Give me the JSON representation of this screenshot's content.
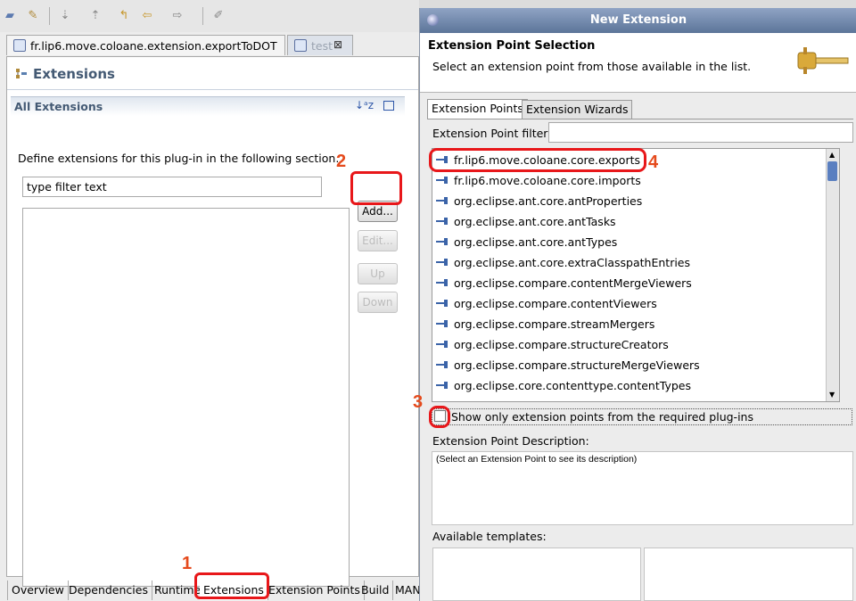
{
  "editor": {
    "tabs": [
      "fr.lip6.move.coloane.extension.exportToDOT",
      "test"
    ],
    "title": "Extensions",
    "section_title": "All Extensions",
    "section_desc": "Define extensions for this plug-in in the following section.",
    "filter_value": "type filter text",
    "buttons": {
      "add": "Add...",
      "edit": "Edit...",
      "up": "Up",
      "down": "Down"
    },
    "bottom_tabs": [
      "Overview",
      "Dependencies",
      "Runtime",
      "Extensions",
      "Extension Points",
      "Build",
      "MAN"
    ]
  },
  "dialog": {
    "title": "New Extension",
    "header_title": "Extension Point Selection",
    "header_desc": "Select an extension point from those available in the list.",
    "tabs": [
      "Extension Points",
      "Extension Wizards"
    ],
    "filter_label": "Extension Point filter:",
    "filter_value": "",
    "list": [
      "fr.lip6.move.coloane.core.exports",
      "fr.lip6.move.coloane.core.imports",
      "org.eclipse.ant.core.antProperties",
      "org.eclipse.ant.core.antTasks",
      "org.eclipse.ant.core.antTypes",
      "org.eclipse.ant.core.extraClasspathEntries",
      "org.eclipse.compare.contentMergeViewers",
      "org.eclipse.compare.contentViewers",
      "org.eclipse.compare.streamMergers",
      "org.eclipse.compare.structureCreators",
      "org.eclipse.compare.structureMergeViewers",
      "org.eclipse.core.contenttype.contentTypes"
    ],
    "checkbox_label": "Show only extension points from the required plug-ins",
    "desc_label": "Extension Point Description:",
    "desc_text": "(Select an Extension Point to see its description)",
    "templates_label": "Available templates:"
  },
  "annotations": [
    "1",
    "2",
    "3",
    "4"
  ],
  "colors": {
    "annotation": "#e8171a",
    "number": "#e54a1c",
    "title_blue": "#445a74"
  }
}
